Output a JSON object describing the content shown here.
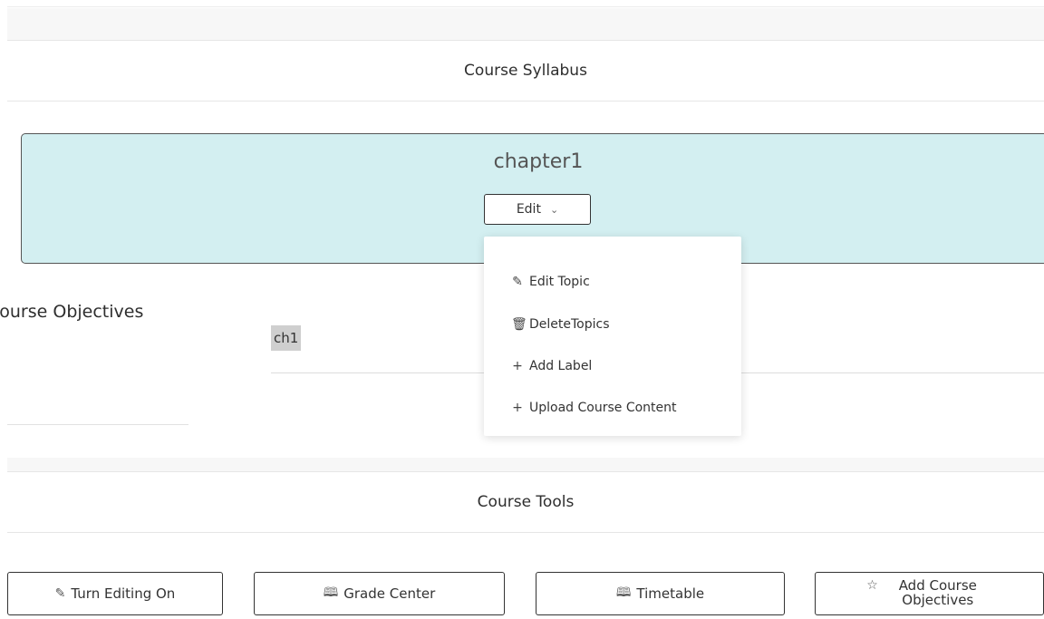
{
  "syllabus": {
    "heading": "Course Syllabus"
  },
  "chapter": {
    "title": "chapter1",
    "edit_label": "Edit",
    "menu": [
      {
        "icon": "edit-icon",
        "glyph": "✎",
        "label": "Edit Topic"
      },
      {
        "icon": "trash-icon",
        "glyph": "🗑",
        "label": "DeleteTopics"
      },
      {
        "icon": "plus-icon",
        "glyph": "+",
        "label": "Add Label"
      },
      {
        "icon": "plus-icon",
        "glyph": "+",
        "label": "Upload Course Content"
      }
    ]
  },
  "objectives": {
    "heading": "Course Objectives",
    "item": "ch1"
  },
  "tools": {
    "heading": "Course Tools",
    "buttons": [
      {
        "icon": "edit-icon",
        "glyph": "✎",
        "label": "Turn Editing On"
      },
      {
        "icon": "book-icon",
        "glyph": "🕮",
        "label": "Grade Center"
      },
      {
        "icon": "book-icon",
        "glyph": "🕮",
        "label": "Timetable"
      },
      {
        "icon": "star-icon",
        "glyph": "☆",
        "label": "Add Course Objectives"
      }
    ]
  }
}
